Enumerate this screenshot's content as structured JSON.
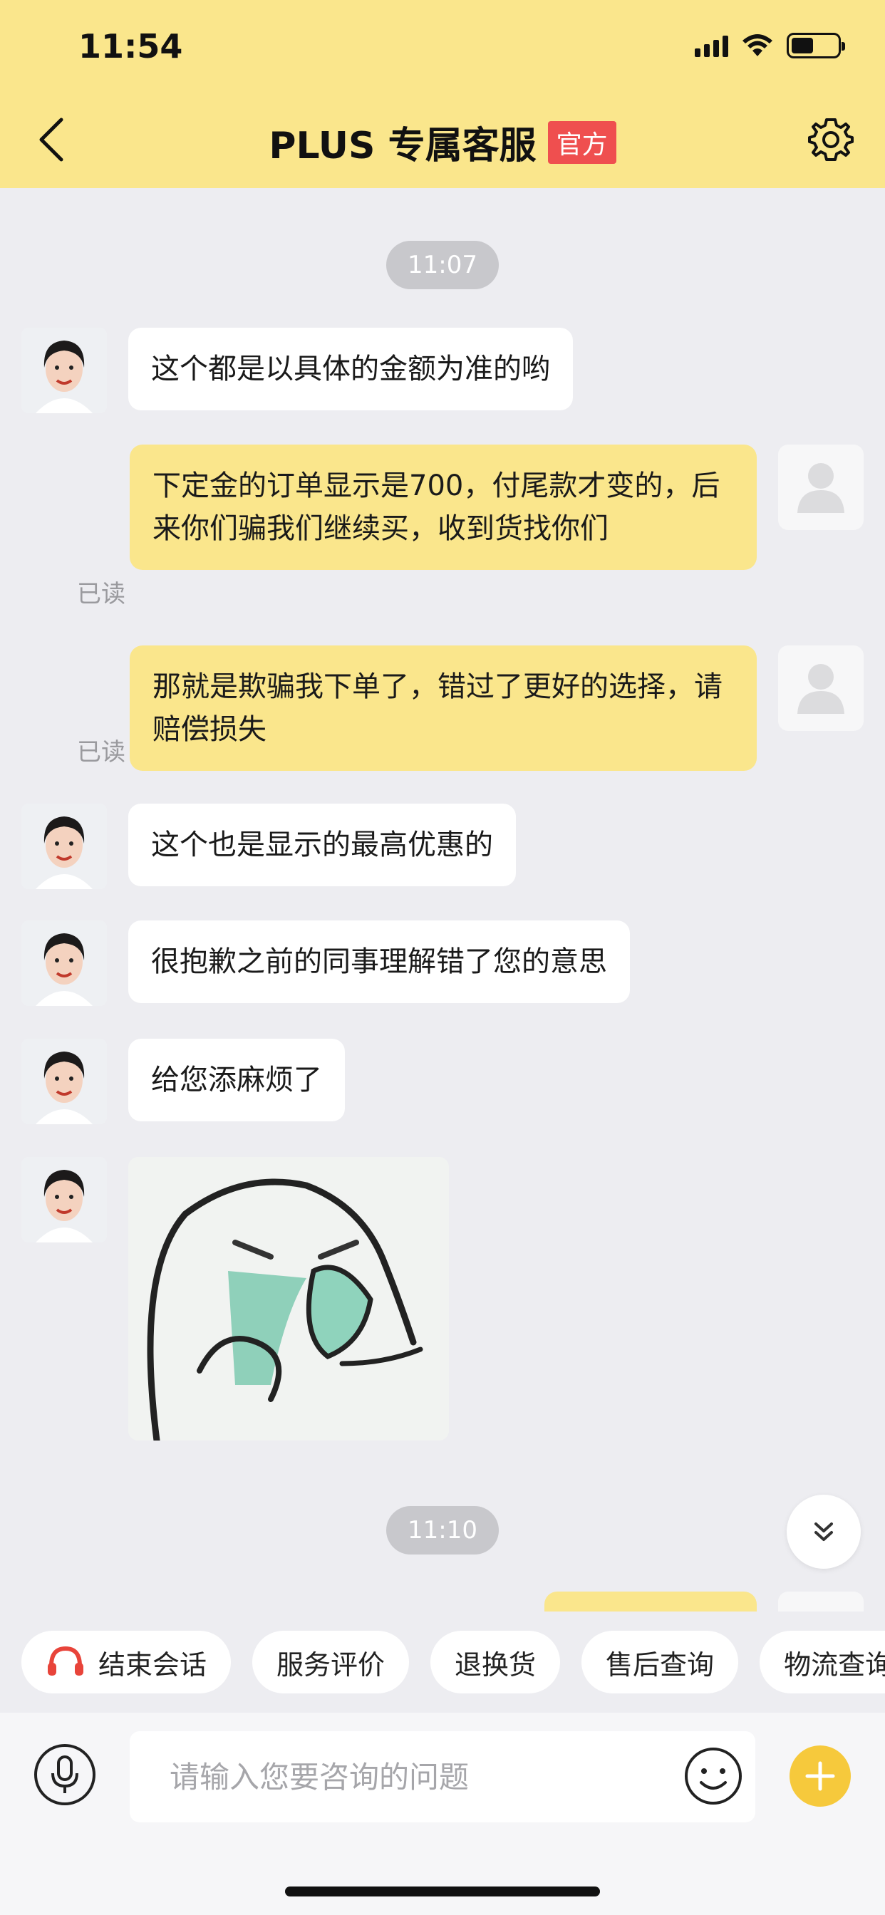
{
  "status_bar": {
    "time": "11:54"
  },
  "header": {
    "title": "PLUS 专属客服",
    "badge": "官方"
  },
  "messages": [
    {
      "type": "time",
      "text": "11:07"
    },
    {
      "type": "agent",
      "text": "这个都是以具体的金额为准的哟"
    },
    {
      "type": "user",
      "text": "下定金的订单显示是700，付尾款才变的，后来你们骗我们继续买，收到货找你们",
      "status": "已读"
    },
    {
      "type": "user",
      "text": "那就是欺骗我下单了，错过了更好的选择，请赔偿损失",
      "status": "已读"
    },
    {
      "type": "agent",
      "text": "这个也是显示的最高优惠的"
    },
    {
      "type": "agent",
      "text": "很抱歉之前的同事理解错了您的意思"
    },
    {
      "type": "agent",
      "text": "给您添麻烦了"
    },
    {
      "type": "agent-sticker",
      "sticker": "facepalm-sticker"
    },
    {
      "type": "time",
      "text": "11:10"
    }
  ],
  "quick_actions": [
    {
      "label": "结束会话",
      "icon": "headset-icon"
    },
    {
      "label": "服务评价"
    },
    {
      "label": "退换货"
    },
    {
      "label": "售后查询"
    },
    {
      "label": "物流查询"
    }
  ],
  "input": {
    "placeholder": "请输入您要咨询的问题",
    "value": ""
  },
  "colors": {
    "header_bg": "#fae68c",
    "user_bubble": "#fae68c",
    "badge": "#ef4f4f",
    "plus_button": "#f6c93c",
    "headset": "#e8443a"
  }
}
